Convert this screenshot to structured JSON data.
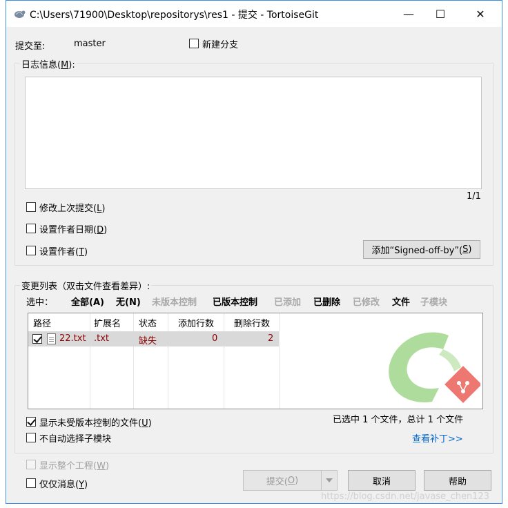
{
  "window": {
    "title": "C:\\Users\\71900\\Desktop\\repositorys\\res1 - 提交 - TortoiseGit",
    "minimize_glyph": "—",
    "maximize_glyph": "☐",
    "close_glyph": "✕"
  },
  "commit": {
    "commit_to_label": "提交至:",
    "branch": "master",
    "new_branch_label": "新建分支",
    "message_group_label": "日志信息(M):",
    "message_group_prefix": "日志信息(",
    "message_group_key": "M",
    "message_group_suffix": "):",
    "message_value": "",
    "message_counter": "1/1",
    "amend_prefix": "修改上次提交(",
    "amend_key": "L",
    "amend_suffix": ")",
    "set_date_prefix": "设置作者日期(",
    "set_date_key": "D",
    "set_date_suffix": ")",
    "set_author_prefix": "设置作者(",
    "set_author_key": "T",
    "set_author_suffix": ")",
    "signed_off_prefix": "添加“Signed-off-by”(",
    "signed_off_key": "S",
    "signed_off_suffix": ")"
  },
  "changes": {
    "group_label": "变更列表（双击文件查看差异）:",
    "select_label": "选中：",
    "filters": [
      {
        "label": "全部(A)",
        "enabled": true
      },
      {
        "label": "无(N)",
        "enabled": true
      },
      {
        "label": "未版本控制",
        "enabled": false
      },
      {
        "label": "已版本控制",
        "enabled": true
      },
      {
        "label": "已添加",
        "enabled": false
      },
      {
        "label": "已删除",
        "enabled": true
      },
      {
        "label": "已修改",
        "enabled": false
      },
      {
        "label": "文件",
        "enabled": true
      },
      {
        "label": "子模块",
        "enabled": false
      }
    ],
    "columns": [
      "路径",
      "扩展名",
      "状态",
      "添加行数",
      "删除行数"
    ],
    "rows": [
      {
        "checked": true,
        "path": "22.txt",
        "ext": ".txt",
        "status": "缺失",
        "added": "0",
        "deleted": "2"
      }
    ],
    "summary": "已选中 1 个文件，总计 1 个文件",
    "show_unversioned_prefix": "显示未受版本控制的文件(",
    "show_unversioned_key": "U",
    "show_unversioned_suffix": ")",
    "show_unversioned_checked": true,
    "no_autoselect_submodules": "不自动选择子模块",
    "view_patch": "查看补丁>>"
  },
  "footer": {
    "whole_project_prefix": "显示整个工程(",
    "whole_project_key": "W",
    "whole_project_suffix": ")",
    "message_only_prefix": "仅仅消息(",
    "message_only_key": "Y",
    "message_only_suffix": ")",
    "commit_prefix": "提交(",
    "commit_key": "O",
    "commit_suffix": ")",
    "cancel": "取消",
    "help": "帮助",
    "watermark": "https://blog.csdn.net/javase_chen123"
  },
  "colors": {
    "accent_border": "#3a8ee6",
    "missing_status": "#8b0000",
    "link": "#0066cc",
    "logo_green": "#6cc04a",
    "logo_red": "#e8554e"
  }
}
